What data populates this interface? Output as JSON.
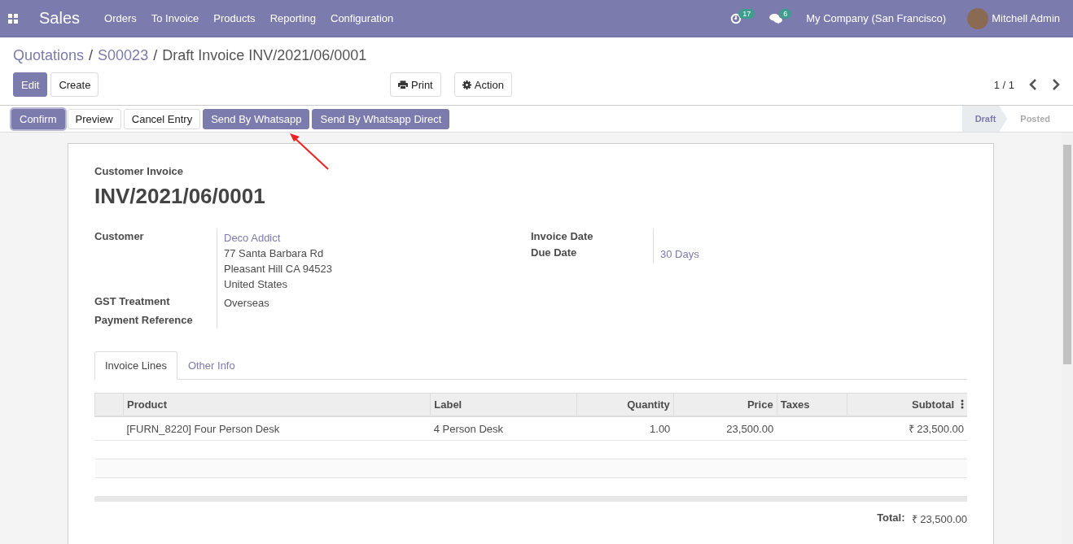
{
  "navbar": {
    "app": "Sales",
    "menu": [
      "Orders",
      "To Invoice",
      "Products",
      "Reporting",
      "Configuration"
    ],
    "activity_count": "17",
    "message_count": "6",
    "company": "My Company (San Francisco)",
    "user": "Mitchell Admin"
  },
  "breadcrumbs": [
    {
      "label": "Quotations",
      "link": true
    },
    {
      "separator": "/",
      "label": "S00023",
      "link": true
    },
    {
      "separator": "/",
      "label": "Draft Invoice INV/2021/06/0001",
      "link": false
    }
  ],
  "control_buttons": [
    {
      "label": "Edit",
      "primary": true
    },
    {
      "label": "Create",
      "primary": false
    }
  ],
  "action_buttons": [
    {
      "label": "Print",
      "kind": "print"
    },
    {
      "label": "Action",
      "kind": "gear"
    }
  ],
  "pager": "1 / 1",
  "header_buttons": [
    {
      "label": "Confirm",
      "primary": true
    },
    {
      "label": "Preview",
      "primary": false
    },
    {
      "label": "Cancel Entry",
      "primary": false
    },
    {
      "label": "Send By Whatsapp",
      "primary": true
    },
    {
      "label": "Send By Whatsapp Direct",
      "primary": true
    }
  ],
  "stages": [
    {
      "label": "Draft",
      "selected": true
    },
    {
      "label": "Posted",
      "selected": false
    }
  ],
  "sheet": {
    "subtitle": "Customer Invoice",
    "title": "INV/2021/06/0001",
    "left_fields": [
      {
        "label": "Customer",
        "lines": [
          {
            "text": "Deco Addict",
            "link": true
          },
          {
            "text": "77 Santa Barbara Rd",
            "link": false
          },
          {
            "text": "Pleasant Hill CA 94523",
            "link": false
          },
          {
            "text": "United States",
            "link": false
          }
        ]
      },
      {
        "label": "GST Treatment",
        "lines": [
          {
            "text": "Overseas",
            "link": false
          }
        ]
      },
      {
        "label": "Payment Reference"
      }
    ],
    "right_fields": [
      {
        "label": "Invoice Date"
      },
      {
        "label": "Due Date",
        "lines": [
          {
            "text": "30 Days",
            "link": true
          }
        ]
      }
    ],
    "tabs": [
      {
        "label": "Invoice Lines",
        "selected": true
      },
      {
        "label": "Other Info",
        "selected": false
      }
    ],
    "table": {
      "columns": [
        {
          "label": "Product",
          "kind": "text"
        },
        {
          "label": "Label",
          "kind": "text"
        },
        {
          "label": "Quantity",
          "kind": "number"
        },
        {
          "label": "Price",
          "kind": "number"
        },
        {
          "label": "Taxes",
          "kind": "text"
        },
        {
          "label": "Subtotal",
          "kind": "number"
        }
      ],
      "rows": [
        [
          "[FURN_8220] Four Person Desk",
          "4 Person Desk",
          "1.00",
          "23,500.00",
          "",
          "₹ 23,500.00"
        ]
      ]
    },
    "total_label": "Total:",
    "total_value": "₹ 23,500.00"
  }
}
